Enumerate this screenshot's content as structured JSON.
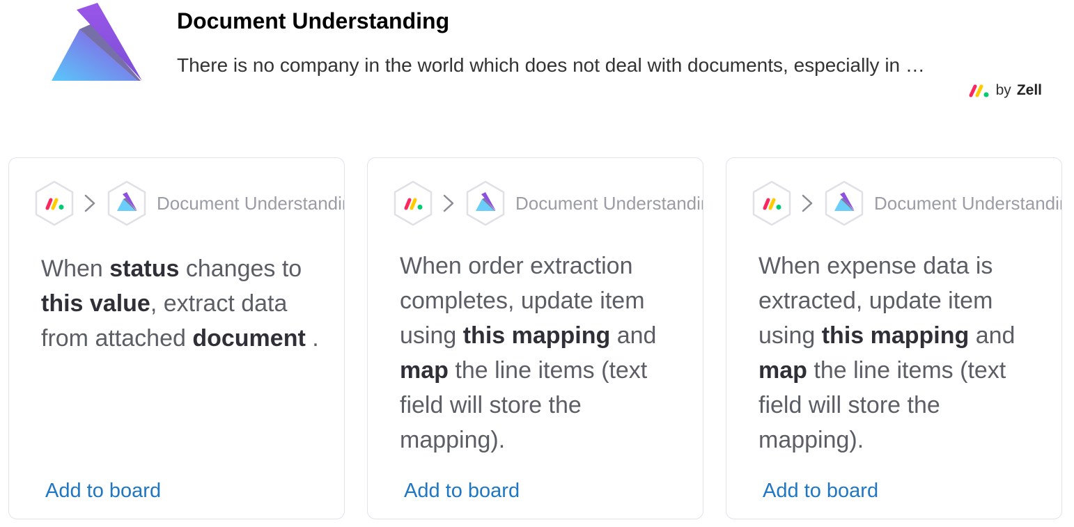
{
  "app": {
    "title": "Document Understanding",
    "description": "There is no company in the world which does not deal with documents, especially in …",
    "author_prefix": "by",
    "author_name": "Zell"
  },
  "cards": [
    {
      "header_title": "Document Understanding",
      "recipe": [
        {
          "t": "When ",
          "b": false
        },
        {
          "t": "status",
          "b": true
        },
        {
          "t": " changes to ",
          "b": false
        },
        {
          "t": "this value",
          "b": true
        },
        {
          "t": ", extract data from attached ",
          "b": false
        },
        {
          "t": "document",
          "b": true
        },
        {
          "t": " .",
          "b": false
        }
      ],
      "action_label": "Add to board"
    },
    {
      "header_title": "Document Understanding",
      "recipe": [
        {
          "t": "When order extraction completes, update item using ",
          "b": false
        },
        {
          "t": "this mapping",
          "b": true
        },
        {
          "t": " and ",
          "b": false
        },
        {
          "t": "map",
          "b": true
        },
        {
          "t": " the line items (text field will store the mapping).",
          "b": false
        }
      ],
      "action_label": "Add to board"
    },
    {
      "header_title": "Document Understanding",
      "recipe": [
        {
          "t": "When expense data is extracted, update item using ",
          "b": false
        },
        {
          "t": "this mapping",
          "b": true
        },
        {
          "t": " and ",
          "b": false
        },
        {
          "t": "map",
          "b": true
        },
        {
          "t": " the line items (text field will store the mapping).",
          "b": false
        }
      ],
      "action_label": "Add to board"
    }
  ],
  "colors": {
    "link": "#1f76c2",
    "monday_red": "#fb275d",
    "monday_yellow": "#ffcc00",
    "monday_green": "#00ca72",
    "logo_purple": "#8e50e0",
    "logo_blue": "#5ac8fa"
  },
  "icons": {
    "app_logo": "document-understanding-logo",
    "monday_logo": "monday-logo",
    "chevron": "chevron-right-icon"
  }
}
